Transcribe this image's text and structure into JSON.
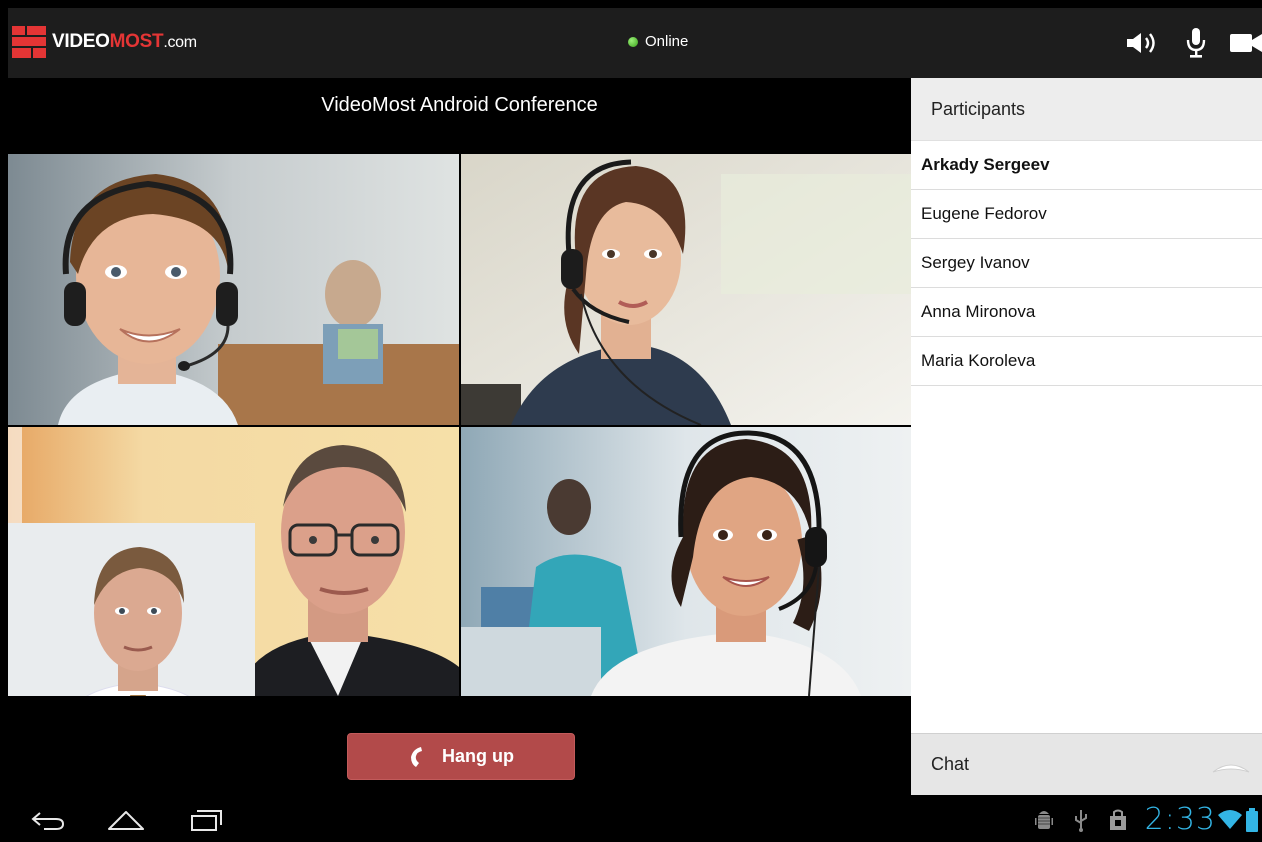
{
  "app": {
    "logo": {
      "part1": "VIDEO",
      "part2": "MOST",
      "part3": ".com"
    },
    "status": "Online",
    "colors": {
      "brand": "#e43535",
      "status_green": "#4caf1f",
      "hangup": "#b24a4a",
      "clock": "#33b5e5"
    }
  },
  "toolbar_icons": [
    "speaker-icon",
    "microphone-icon",
    "camera-icon"
  ],
  "conference": {
    "title": "VideoMost Android Conference",
    "hangup_label": "Hang up"
  },
  "sidebar": {
    "header": "Participants",
    "participants": [
      {
        "name": "Arkady Sergeev",
        "active": true
      },
      {
        "name": "Eugene Fedorov",
        "active": false
      },
      {
        "name": "Sergey Ivanov",
        "active": false
      },
      {
        "name": "Anna Mironova",
        "active": false
      },
      {
        "name": "Maria Koroleva",
        "active": false
      }
    ],
    "chat_label": "Chat"
  },
  "system_bar": {
    "time": "2:33",
    "nav_icons": [
      "back-icon",
      "home-icon",
      "recent-apps-icon"
    ],
    "status_icons": [
      "android-debug-icon",
      "usb-icon",
      "shopping-bag-icon",
      "wifi-icon",
      "battery-icon"
    ]
  }
}
